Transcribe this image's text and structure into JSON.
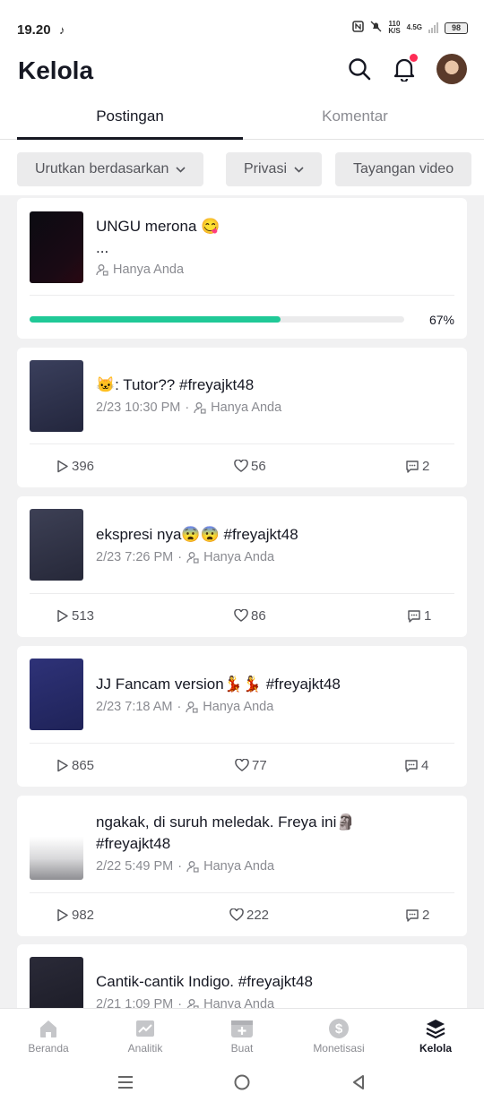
{
  "status_bar": {
    "time": "19.20",
    "speed_top": "110",
    "speed_bottom": "K/S",
    "network": "4.5G",
    "battery": "98"
  },
  "header": {
    "title": "Kelola"
  },
  "tabs": [
    {
      "label": "Postingan",
      "active": true
    },
    {
      "label": "Komentar",
      "active": false
    }
  ],
  "filters": [
    {
      "label": "Urutkan berdasarkan"
    },
    {
      "label": "Privasi"
    },
    {
      "label": "Tayangan video"
    }
  ],
  "uploading_post": {
    "title": "UNGU merona 😋",
    "title_line2": "...",
    "privacy": "Hanya Anda",
    "progress": 0.67,
    "progress_label": "67%"
  },
  "posts": [
    {
      "title": "🐱: Tutor?? #freyajkt48",
      "date": "2/23 10:30 PM",
      "privacy": "Hanya Anda",
      "views": "396",
      "likes": "56",
      "comments": "2"
    },
    {
      "title": "ekspresi nya😨😨 #freyajkt48",
      "date": "2/23 7:26 PM",
      "privacy": "Hanya Anda",
      "views": "513",
      "likes": "86",
      "comments": "1"
    },
    {
      "title": "JJ Fancam version💃💃 #freyajkt48",
      "date": "2/23 7:18 AM",
      "privacy": "Hanya Anda",
      "views": "865",
      "likes": "77",
      "comments": "4"
    },
    {
      "title": "ngakak, di suruh meledak. Freya ini🗿",
      "title_line2": "#freyajkt48",
      "date": "2/22 5:49 PM",
      "privacy": "Hanya Anda",
      "views": "982",
      "likes": "222",
      "comments": "2"
    },
    {
      "title": "Cantik-cantik Indigo. #freyajkt48",
      "date": "2/21 1:09 PM",
      "privacy": "Hanya Anda"
    }
  ],
  "bottom_nav": [
    {
      "label": "Beranda",
      "icon": "home-icon",
      "active": false
    },
    {
      "label": "Analitik",
      "icon": "chart-icon",
      "active": false
    },
    {
      "label": "Buat",
      "icon": "create-icon",
      "active": false
    },
    {
      "label": "Monetisasi",
      "icon": "dollar-icon",
      "active": false
    },
    {
      "label": "Kelola",
      "icon": "layers-icon",
      "active": true
    }
  ],
  "colors": {
    "accent": "#fe2c55",
    "progress": "#20c997",
    "text_primary": "#161823",
    "text_secondary": "#8a8b91"
  }
}
